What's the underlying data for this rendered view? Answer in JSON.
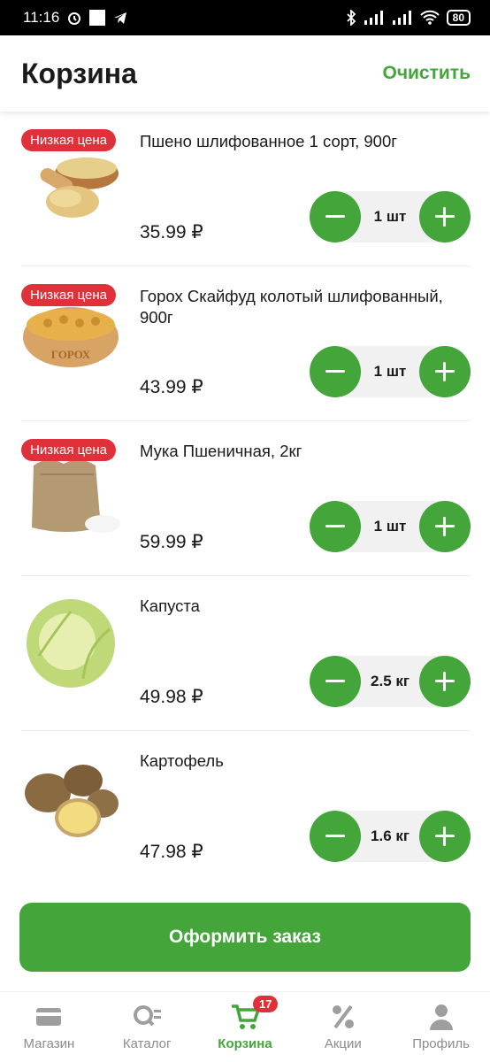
{
  "status_bar": {
    "time": "11:16",
    "battery": "80"
  },
  "header": {
    "title": "Корзина",
    "clear_label": "Очистить"
  },
  "items": [
    {
      "name": "Пшено шлифованное 1 сорт, 900г",
      "price": "35.99 ₽",
      "qty": "1 шт",
      "badge": "Низкая цена"
    },
    {
      "name": "Горох Скайфуд колотый шлифованный, 900г",
      "price": "43.99 ₽",
      "qty": "1 шт",
      "badge": "Низкая цена",
      "img_text": "ГОРОХ"
    },
    {
      "name": "Мука Пшеничная, 2кг",
      "price": "59.99 ₽",
      "qty": "1 шт",
      "badge": "Низкая цена"
    },
    {
      "name": "Капуста",
      "price": "49.98 ₽",
      "qty": "2.5 кг"
    },
    {
      "name": "Картофель",
      "price": "47.98 ₽",
      "qty": "1.6 кг"
    }
  ],
  "order_button": "Оформить заказ",
  "nav": {
    "shop": "Магазин",
    "catalog": "Каталог",
    "cart": "Корзина",
    "cart_badge": "17",
    "promo": "Акции",
    "profile": "Профиль"
  },
  "colors": {
    "accent": "#43a53a",
    "badge": "#e0303a"
  }
}
